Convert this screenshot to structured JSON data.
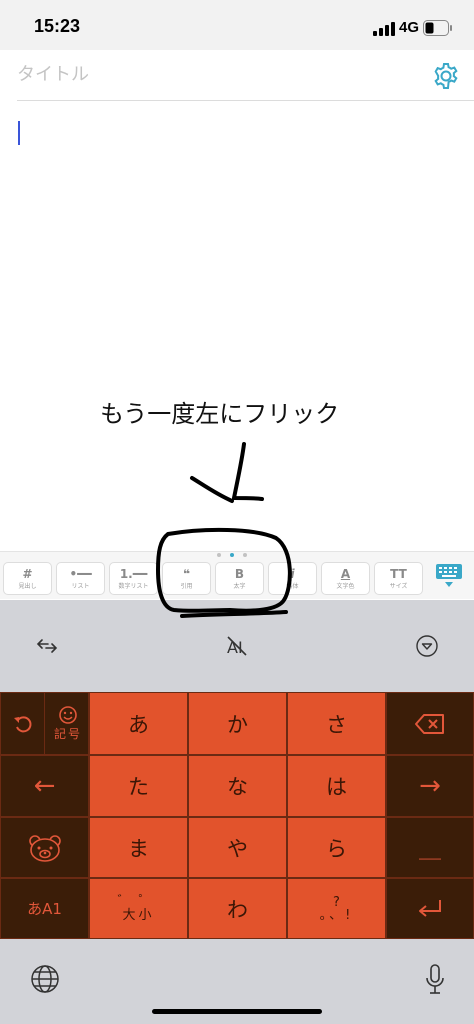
{
  "status_bar": {
    "time": "15:23",
    "network": "4G"
  },
  "editor": {
    "title_placeholder": "タイトル",
    "body_text": ""
  },
  "annotation": {
    "text": "もう一度左にフリック"
  },
  "format_toolbar": {
    "buttons": [
      {
        "glyph": "#",
        "label": "見出し",
        "icon": "heading-icon"
      },
      {
        "glyph": "•━━",
        "label": "リスト",
        "icon": "bullet-list-icon"
      },
      {
        "glyph": "1.━━",
        "label": "数字リスト",
        "icon": "numbered-list-icon"
      },
      {
        "glyph": "❝",
        "label": "引用",
        "icon": "quote-icon"
      },
      {
        "glyph": "B",
        "label": "太字",
        "icon": "bold-icon"
      },
      {
        "glyph": "i",
        "label": "斜体",
        "icon": "italic-icon"
      },
      {
        "glyph": "A",
        "label": "文字色",
        "icon": "text-color-icon"
      },
      {
        "glyph": "TT",
        "label": "サイズ",
        "icon": "text-size-icon"
      }
    ]
  },
  "keyboard": {
    "tools": [
      "cursor-move-icon",
      "ai-off-icon",
      "collapse-keyboard-icon"
    ],
    "kana_keys": [
      "あ",
      "か",
      "さ",
      "た",
      "な",
      "は",
      "ま",
      "や",
      "ら",
      "わ"
    ],
    "kigou_label": "記号",
    "dakuten_top": "゛゜",
    "dakuten_bottom": "大小",
    "punct_top": "?",
    "punct_bottom": "。、!",
    "mode_label": "あA1",
    "left_arrow": "←",
    "right_arrow": "→",
    "space_bar": "＿"
  },
  "colors": {
    "key_orange": "#e2532c",
    "key_dark": "#3b1d08",
    "accent": "#3aa8c8"
  }
}
